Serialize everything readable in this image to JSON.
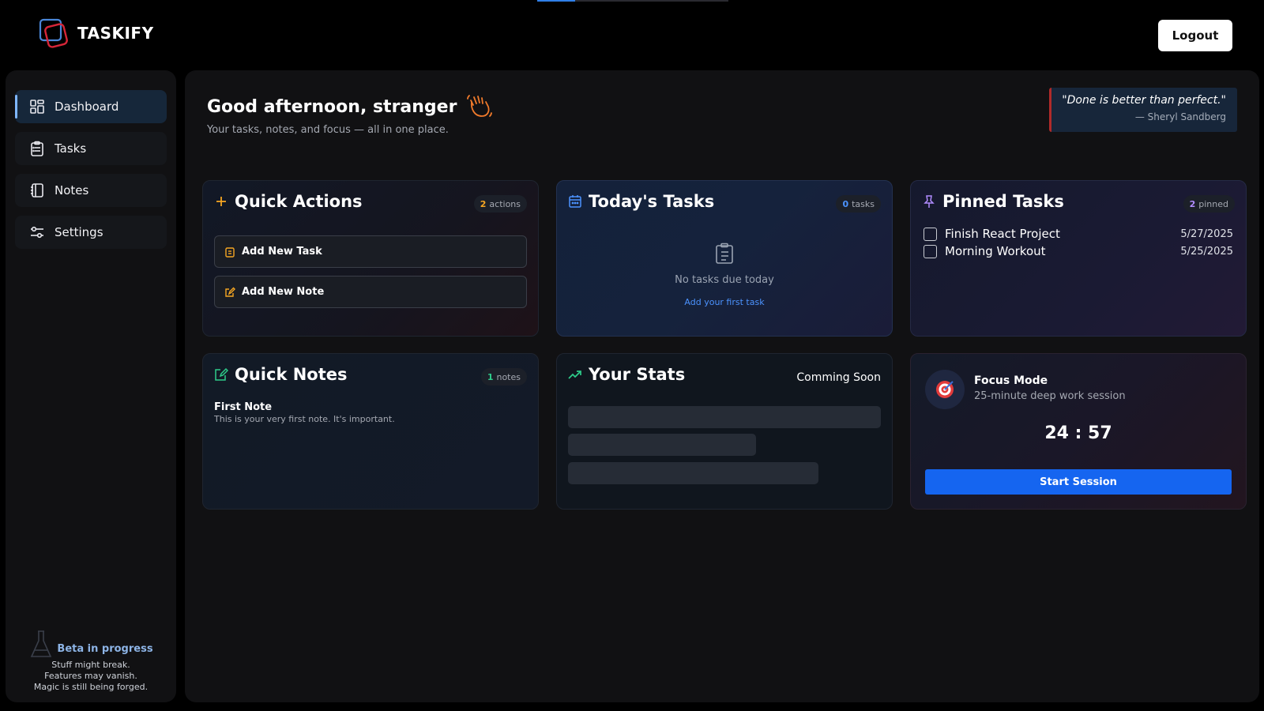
{
  "app": {
    "name": "TASKIFY",
    "logout_label": "Logout"
  },
  "sidebar": {
    "items": [
      {
        "label": "Dashboard",
        "icon": "dashboard-icon",
        "active": true
      },
      {
        "label": "Tasks",
        "icon": "clipboard-icon",
        "active": false
      },
      {
        "label": "Notes",
        "icon": "notebook-icon",
        "active": false
      },
      {
        "label": "Settings",
        "icon": "sliders-icon",
        "active": false
      }
    ],
    "beta": {
      "title": "Beta in progress",
      "lines": [
        "Stuff might break.",
        "Features may vanish.",
        "Magic is still being forged."
      ]
    }
  },
  "main": {
    "greeting": "Good afternoon, stranger",
    "subtitle": "Your tasks, notes, and focus — all in one place.",
    "quote": {
      "text": "\"Done is better than perfect.\"",
      "author": "— Sheryl Sandberg"
    }
  },
  "cards": {
    "quick_actions": {
      "title": "Quick Actions",
      "count": "2",
      "count_label": "actions",
      "buttons": [
        {
          "label": "Add New Task"
        },
        {
          "label": "Add New Note"
        }
      ]
    },
    "todays_tasks": {
      "title": "Today's Tasks",
      "count": "0",
      "count_label": "tasks",
      "empty_text": "No tasks due today",
      "empty_link": "Add your first task"
    },
    "pinned_tasks": {
      "title": "Pinned Tasks",
      "count": "2",
      "count_label": "pinned",
      "items": [
        {
          "label": "Finish React Project",
          "date": "5/27/2025",
          "checked": false
        },
        {
          "label": "Morning Workout",
          "date": "5/25/2025",
          "checked": false
        }
      ]
    },
    "quick_notes": {
      "title": "Quick Notes",
      "count": "1",
      "count_label": "notes",
      "notes": [
        {
          "title": "First Note",
          "body": "This is your very first note. It's important."
        }
      ]
    },
    "your_stats": {
      "title": "Your Stats",
      "status": "Comming Soon"
    },
    "focus_mode": {
      "title": "Focus Mode",
      "subtitle": "25-minute deep work session",
      "timer": "24 : 57",
      "button_label": "Start Session"
    }
  },
  "colors": {
    "accent_blue": "#1565f0",
    "link_blue": "#4c93ff",
    "orange": "#f5a623",
    "green": "#2ecc8a",
    "purple": "#b18cff",
    "quote_border": "#b02a2a"
  }
}
